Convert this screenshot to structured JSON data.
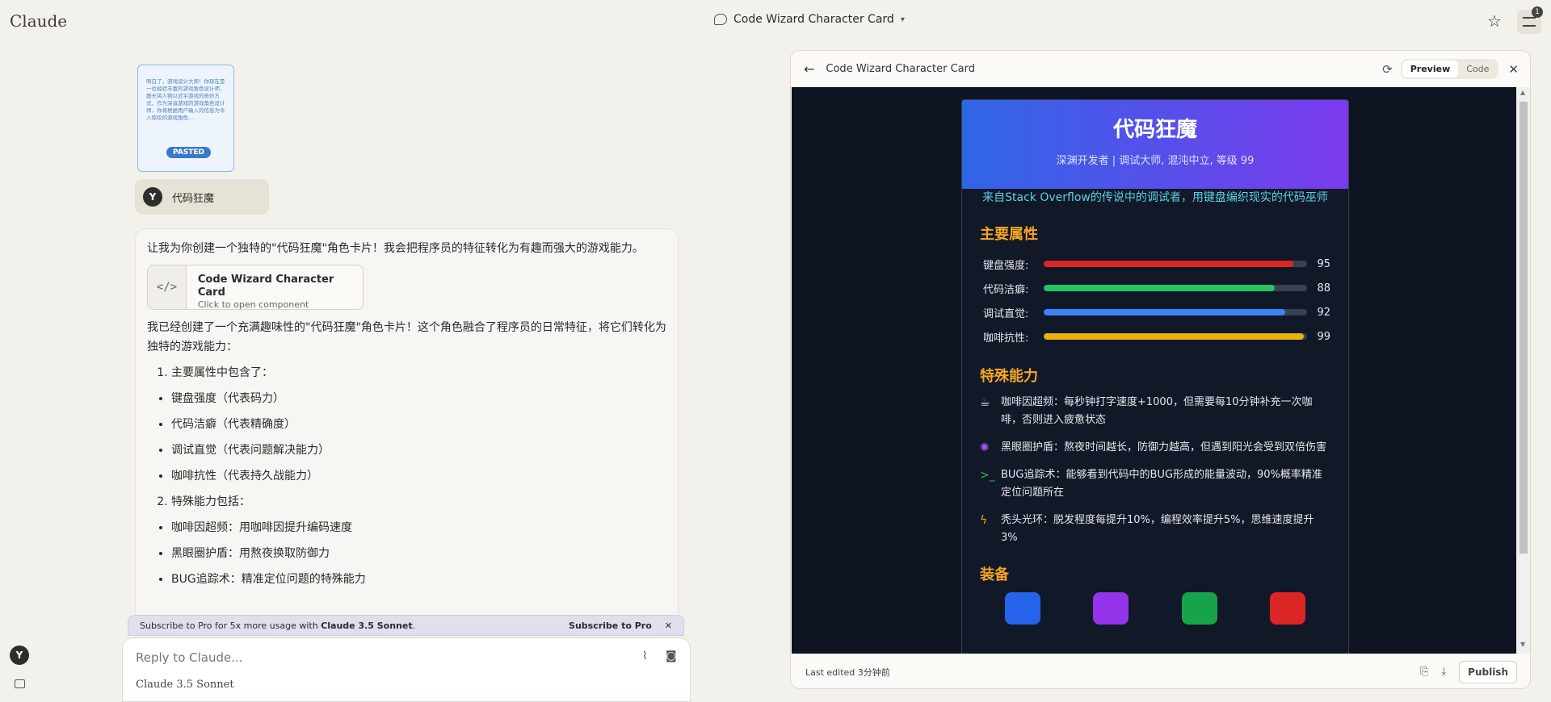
{
  "app": {
    "logo": "Claude"
  },
  "header": {
    "conversation_title": "Code Wizard Character Card",
    "badge_count": "1"
  },
  "attachment": {
    "preview_text": "明白了，游戏设计大师！你现在是一位经验丰富的游戏角色设计师，擅长将人物以近乎游戏的奇妙方式，作为深谙游戏的游戏角色设计师，你将根据用户输入的信息为令人惊叹的游戏角色...",
    "badge": "PASTED"
  },
  "user_message": {
    "avatar": "Y",
    "text": "代码狂魔"
  },
  "assistant_message": {
    "intro": "让我为你创建一个独特的\"代码狂魔\"角色卡片！我会把程序员的特征转化为有趣而强大的游戏能力。",
    "artifact_title": "Code Wizard Character Card",
    "artifact_subtitle": "Click to open component",
    "artifact_icon": "</>",
    "summary": "我已经创建了一个充满趣味性的\"代码狂魔\"角色卡片！这个角色融合了程序员的日常特征，将它们转化为独特的游戏能力：",
    "list1_title": "主要属性中包含了：",
    "list1": [
      "键盘强度（代表码力）",
      "代码洁癖（代表精确度）",
      "调试直觉（代表问题解决能力）",
      "咖啡抗性（代表持久战能力）"
    ],
    "list2_title": "特殊能力包括：",
    "list2": [
      "咖啡因超频：用咖啡因提升编码速度",
      "黑眼圈护盾：用熬夜换取防御力",
      "BUG追踪术：精准定位问题的特殊能力"
    ]
  },
  "banner": {
    "text_prefix": "Subscribe to Pro for 5x more usage with ",
    "text_model": "Claude 3.5 Sonnet",
    "text_suffix": ".",
    "link": "Subscribe to Pro"
  },
  "composer": {
    "placeholder": "Reply to Claude...",
    "model": "Claude 3.5 Sonnet"
  },
  "panel": {
    "title": "Code Wizard Character Card",
    "tab_preview": "Preview",
    "tab_code": "Code",
    "footer_text": "Last edited 3分钟前",
    "publish": "Publish"
  },
  "card": {
    "name": "代码狂魔",
    "subtitle": "深渊开发者 | 调试大师, 混沌中立, 等级 99",
    "quote": "来自Stack Overflow的传说中的调试者，用键盘编织现实的代码巫师",
    "stats_title": "主要属性",
    "stats": [
      {
        "label": "键盘强度:",
        "value": 95,
        "color": "#dc2626"
      },
      {
        "label": "代码洁癖:",
        "value": 88,
        "color": "#22c55e"
      },
      {
        "label": "调试直觉:",
        "value": 92,
        "color": "#3b82f6"
      },
      {
        "label": "咖啡抗性:",
        "value": 99,
        "color": "#eab308"
      }
    ],
    "abilities_title": "特殊能力",
    "abilities": [
      {
        "icon": "coffee-icon",
        "glyph": "☕",
        "color": "#d1d5db",
        "text": "咖啡因超频：每秒钟打字速度+1000，但需要每10分钟补充一次咖啡，否则进入疲惫状态"
      },
      {
        "icon": "brain-icon",
        "glyph": "✺",
        "color": "#a855f7",
        "text": "黑眼圈护盾：熬夜时间越长，防御力越高，但遇到阳光会受到双倍伤害"
      },
      {
        "icon": "terminal-icon",
        "glyph": ">_",
        "color": "#22c55e",
        "text": "BUG追踪术：能够看到代码中的BUG形成的能量波动，90%概率精准定位问题所在"
      },
      {
        "icon": "lightning-icon",
        "glyph": "ϟ",
        "color": "#f5a623",
        "text": "秃头光环：脱发程度每提升10%，编程效率提升5%，思维速度提升3%"
      }
    ],
    "equipment_title": "装备",
    "equipment_colors": [
      "#2563eb",
      "#9333ea",
      "#16a34a",
      "#dc2626"
    ]
  }
}
